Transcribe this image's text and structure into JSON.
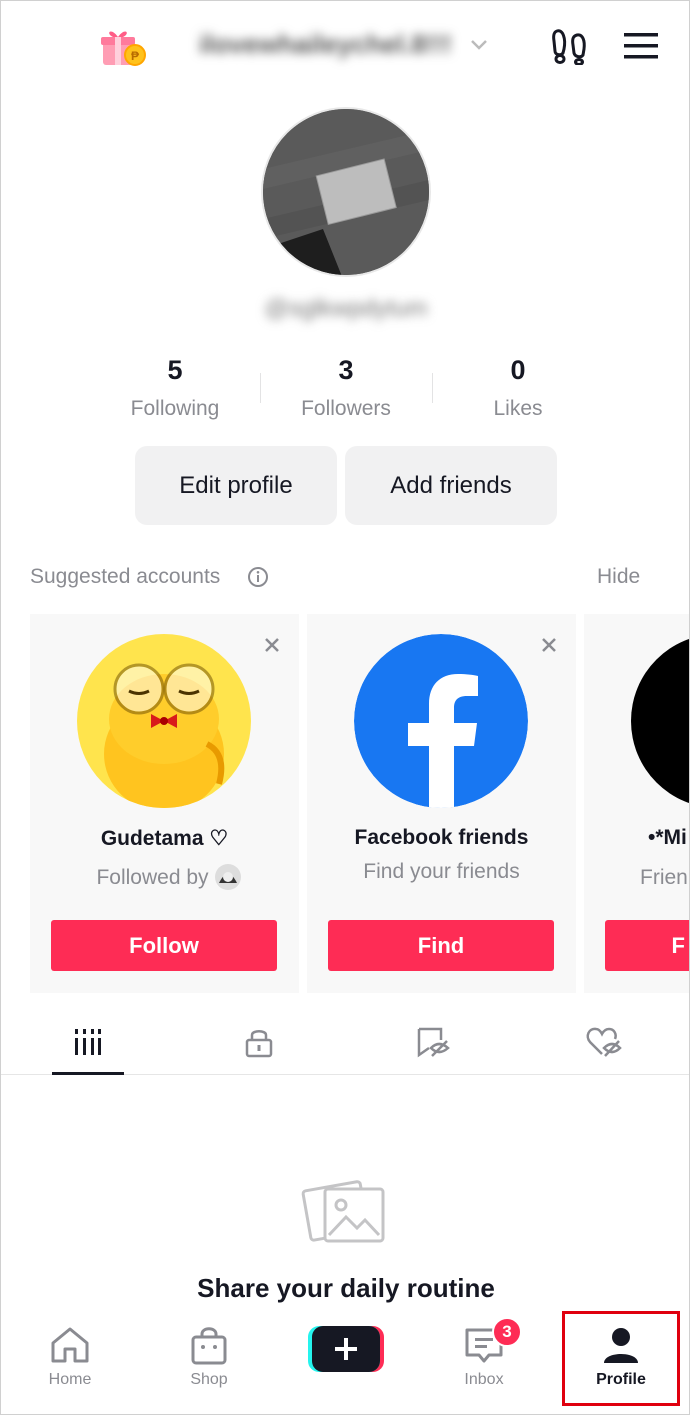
{
  "header": {
    "username": "ilovewhaileychel.8!!!"
  },
  "profile": {
    "handle": "@sglkwpdytum"
  },
  "stats": [
    {
      "value": "5",
      "label": "Following"
    },
    {
      "value": "3",
      "label": "Followers"
    },
    {
      "value": "0",
      "label": "Likes"
    }
  ],
  "actions": {
    "edit_profile": "Edit profile",
    "add_friends": "Add friends"
  },
  "suggested": {
    "title": "Suggested accounts",
    "hide_label": "Hide",
    "cards": [
      {
        "name": "Gudetama ♡",
        "sub": "Followed by",
        "action": "Follow"
      },
      {
        "name": "Facebook friends",
        "sub": "Find your friends",
        "action": "Find"
      },
      {
        "name": "•*Mi",
        "sub": "Frien",
        "action": "F"
      }
    ]
  },
  "empty_state": {
    "title": "Share your daily routine"
  },
  "nav": {
    "home": "Home",
    "shop": "Shop",
    "inbox": "Inbox",
    "inbox_badge": "3",
    "profile": "Profile"
  },
  "colors": {
    "accent": "#fe2c55",
    "highlight": "#e0000f",
    "facebook": "#1877f2"
  }
}
